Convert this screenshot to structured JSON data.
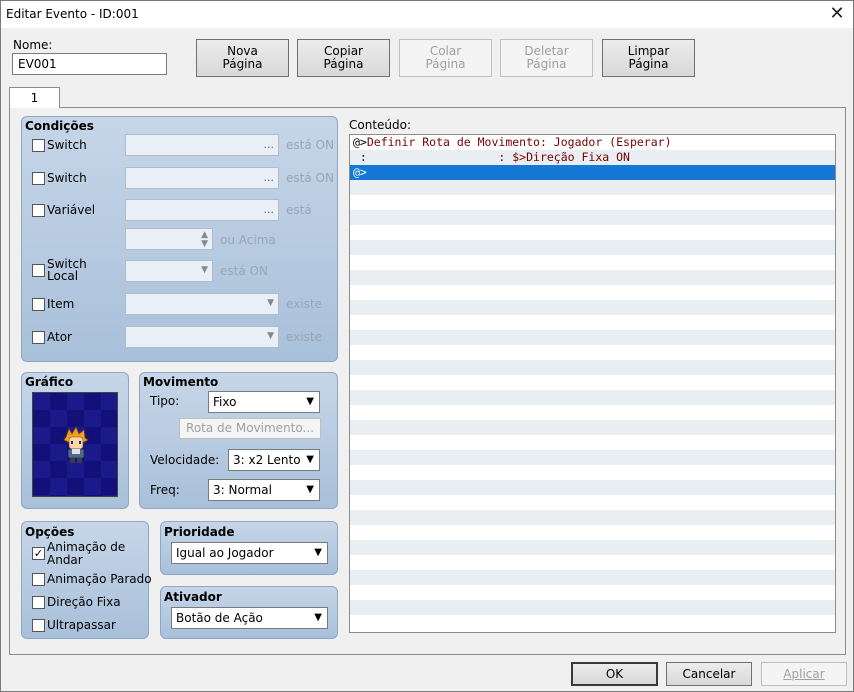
{
  "window": {
    "title": "Editar Evento - ID:001",
    "close_glyph": "✕"
  },
  "name_label": "Nome:",
  "name_value": "EV001",
  "toolbar": [
    {
      "l1": "Nova",
      "l2": "Página",
      "enabled": true
    },
    {
      "l1": "Copiar",
      "l2": "Página",
      "enabled": true
    },
    {
      "l1": "Colar",
      "l2": "Página",
      "enabled": false
    },
    {
      "l1": "Deletar",
      "l2": "Página",
      "enabled": false
    },
    {
      "l1": "Limpar",
      "l2": "Página",
      "enabled": true
    }
  ],
  "tab": "1",
  "conditions": {
    "title": "Condições",
    "switch1": {
      "label": "Switch",
      "suffix": "está ON"
    },
    "switch2": {
      "label": "Switch",
      "suffix": "está ON"
    },
    "variable": {
      "label": "Variável",
      "suffix": "está",
      "suffix2": "ou Acima"
    },
    "self_switch": {
      "label1": "Switch",
      "label2": "Local",
      "suffix": "está ON"
    },
    "item": {
      "label": "Item",
      "suffix": "existe"
    },
    "actor": {
      "label": "Ator",
      "suffix": "existe"
    },
    "dots": "..."
  },
  "graphic": {
    "title": "Gráfico"
  },
  "movement": {
    "title": "Movimento",
    "type_label": "Tipo:",
    "type_value": "Fixo",
    "route_button": "Rota de Movimento...",
    "speed_label": "Velocidade:",
    "speed_value": "3: x2 Lento",
    "freq_label": "Freq:",
    "freq_value": "3: Normal"
  },
  "options": {
    "title": "Opções",
    "walk1": "Animação de",
    "walk2": "Andar",
    "step": "Animação Parado",
    "dir_fix": "Direção Fixa",
    "through": "Ultrapassar",
    "checked_mark": "✓"
  },
  "priority": {
    "title": "Prioridade",
    "value": "Igual ao Jogador"
  },
  "trigger": {
    "title": "Ativador",
    "value": "Botão de Ação"
  },
  "contents": {
    "label": "Conteúdo:",
    "rows": [
      {
        "pre": "@>",
        "text": "Definir Rota de Movimento: Jogador (Esperar)"
      },
      {
        "pre": " :",
        "text": "                   : $>Direção Fixa ON"
      },
      {
        "pre": "@>",
        "text": ""
      }
    ]
  },
  "footer": {
    "ok": "OK",
    "cancel": "Cancelar",
    "apply": "Aplicar"
  }
}
